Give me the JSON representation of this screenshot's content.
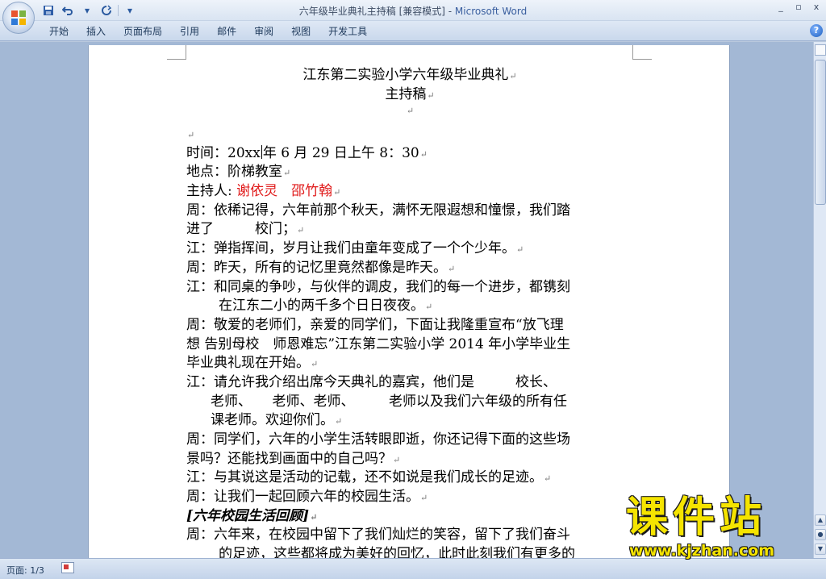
{
  "titlebar": {
    "doc_title": "六年级毕业典礼主持稿 [兼容模式] - ",
    "app_name": "Microsoft Word",
    "minimize": "_",
    "restore": "▫",
    "close": "x"
  },
  "qat": {
    "save_icon": "save-icon",
    "undo_icon": "undo-icon",
    "redo_icon": "redo-icon",
    "customize": "▾"
  },
  "ribbon": {
    "tabs": [
      "开始",
      "插入",
      "页面布局",
      "引用",
      "邮件",
      "审阅",
      "视图",
      "开发工具"
    ],
    "help": "?"
  },
  "document": {
    "title_line1": "江东第二实验小学六年级毕业典礼",
    "title_line2": "主持稿",
    "para_mark": "↵",
    "lines": {
      "time_a": "时间：20xx",
      "time_b": "年 6 月 29 日上午 8：30",
      "place": "地点：阶梯教室",
      "host_label": "主持人:",
      "host_names": "谢依灵　邵竹翰",
      "l1": "周：依稀记得，六年前那个秋天，满怀无限遐想和憧憬，我们踏",
      "l2": "进了　　　校门；",
      "l3": "江：弹指挥间，岁月让我们由童年变成了一个个少年。",
      "l4": "周：昨天，所有的记忆里竟然都像是昨天。",
      "l5": "江：和同桌的争吵，与伙伴的调皮，我们的每一个进步，都镌刻",
      "l6": "在江东二小的两千多个日日夜夜。",
      "l7": "周：敬爱的老师们，亲爱的同学们，下面让我隆重宣布“放飞理",
      "l8": "想 告别母校　师恩难忘”江东第二实验小学 2014 年小学毕业生",
      "l9": "毕业典礼现在开始。",
      "l10": "江：请允许我介绍出席今天典礼的嘉宾，他们是　　　校长、",
      "l11": "老师、　　老师、老师、　　　老师以及我们六年级的所有任",
      "l12": "课老师。欢迎你们。",
      "l13": "周：同学们，六年的小学生活转眼即逝，你还记得下面的这些场",
      "l14": "景吗？还能找到画面中的自己吗？",
      "l15": "江：与其说这是活动的记载，还不如说是我们成长的足迹。",
      "l16": "周：让我们一起回顾六年的校园生活。",
      "l17": "[六年校园生活回顾]",
      "l18": "周：六年来，在校园中留下了我们灿烂的笑容，留下了我们奋斗",
      "l19": "的足迹，这些都将成为美好的回忆，此时此刻我们有更多的"
    }
  },
  "status": {
    "page": "页面: 1/3"
  },
  "watermark": {
    "title": "课件站",
    "url": "www.kjzhan.com"
  },
  "colors": {
    "accent_red": "#e01a1a",
    "watermark_yellow": "#f5e400"
  }
}
